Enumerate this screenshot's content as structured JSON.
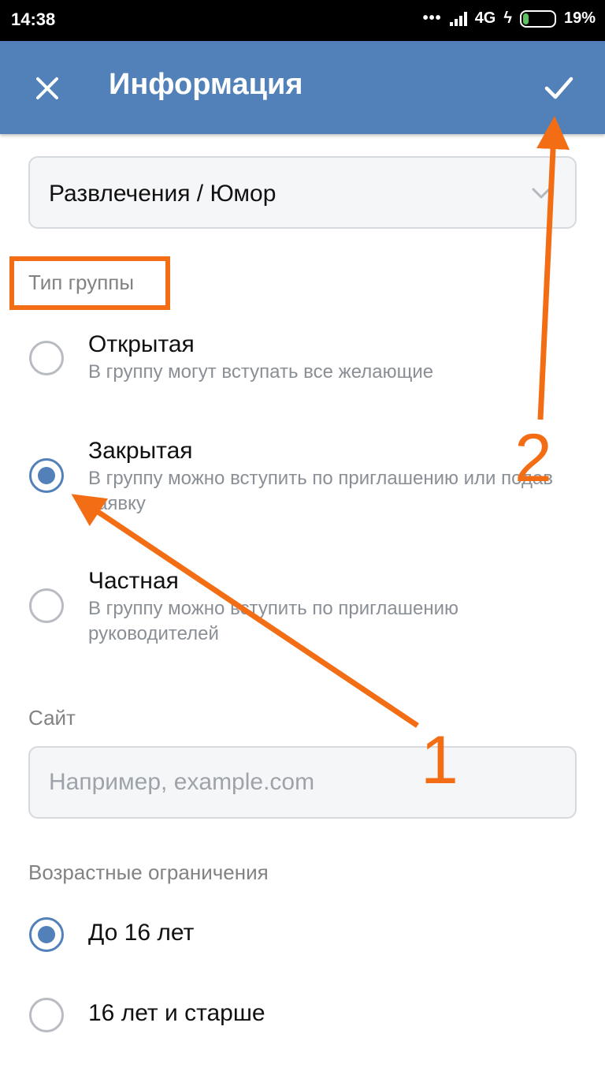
{
  "status_bar": {
    "time": "14:38",
    "network": "4G",
    "battery": "19%",
    "battery_level": 0.19
  },
  "app_bar": {
    "title": "Информация",
    "close_icon": "close-icon",
    "confirm_icon": "check-icon"
  },
  "category": {
    "value": "Развлечения / Юмор"
  },
  "group_type": {
    "label": "Тип группы",
    "options": [
      {
        "title": "Открытая",
        "subtitle": "В группу могут вступать все желающие",
        "checked": false
      },
      {
        "title": "Закрытая",
        "subtitle": "В группу можно вступить по приглашению или подав заявку",
        "checked": true
      },
      {
        "title": "Частная",
        "subtitle": "В группу можно вступить по приглашению руководителей",
        "checked": false
      }
    ]
  },
  "site": {
    "label": "Сайт",
    "placeholder": "Например, example.com"
  },
  "age": {
    "label": "Возрастные ограничения",
    "options": [
      {
        "title": "До 16 лет",
        "checked": true
      },
      {
        "title": "16 лет и старше",
        "checked": false
      }
    ]
  },
  "annotations": {
    "step1": "1",
    "step2": "2",
    "color": "#f36d15"
  }
}
